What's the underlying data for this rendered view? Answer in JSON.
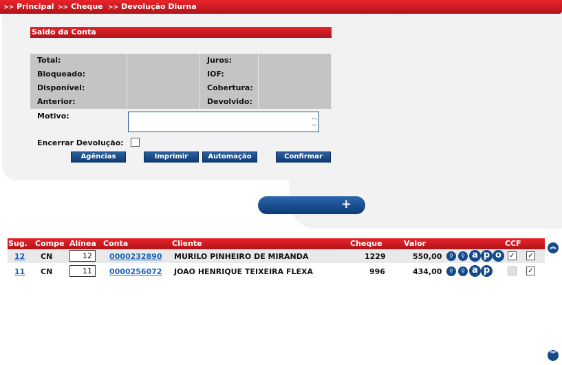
{
  "breadcrumb": {
    "items": [
      "Principal",
      "Cheque",
      "Devolução Diurna"
    ],
    "separator": ">>"
  },
  "saldo": {
    "title": "Saldo da Conta",
    "rows": [
      {
        "left_label": "Total:",
        "left_value": "",
        "right_label": "Juros:",
        "right_value": ""
      },
      {
        "left_label": "Bloqueado:",
        "left_value": "",
        "right_label": "IOF:",
        "right_value": ""
      },
      {
        "left_label": "Disponível:",
        "left_value": "",
        "right_label": "Cobertura:",
        "right_value": ""
      },
      {
        "left_label": "Anterior:",
        "left_value": "",
        "right_label": "Devolvido:",
        "right_value": ""
      }
    ]
  },
  "form": {
    "motivo_label": "Motivo:",
    "motivo_value": "",
    "encerrar_label": "Encerrar Devolução:",
    "encerrar_checked": false
  },
  "buttons": {
    "agencias": "Agências",
    "imprimir": "Imprimir",
    "automacao": "Automação",
    "confirmar": "Confirmar",
    "add": "+"
  },
  "table": {
    "headers": [
      "Sug.",
      "Compe",
      "Alínea",
      "Conta",
      "Cliente",
      "Cheque",
      "Valor",
      "CCF"
    ],
    "rows": [
      {
        "sug": "12",
        "compe": "CN",
        "alinea": "12",
        "conta": "0000232890",
        "cliente": "MURILO PINHEIRO DE MIRANDA",
        "cheque": "1229",
        "valor": "550,00",
        "icons": [
          "search-icon",
          "search-icon",
          "a-icon",
          "p-icon",
          "o-icon"
        ],
        "ccf_enabled": true,
        "ccf_checked": true,
        "sel_checked": true
      },
      {
        "sug": "11",
        "compe": "CN",
        "alinea": "11",
        "conta": "0000256072",
        "cliente": "JOAO HENRIQUE TEIXEIRA FLEXA",
        "cheque": "996",
        "valor": "434,00",
        "icons": [
          "search-icon",
          "search-icon",
          "a-icon",
          "p-icon"
        ],
        "ccf_enabled": false,
        "ccf_checked": false,
        "sel_checked": true
      }
    ]
  },
  "icon_glyphs": {
    "a": "a",
    "p": "p",
    "o": "o"
  },
  "colors": {
    "header_red": "#d81e25",
    "button_blue": "#154a8a",
    "link_blue": "#1a63b8"
  }
}
